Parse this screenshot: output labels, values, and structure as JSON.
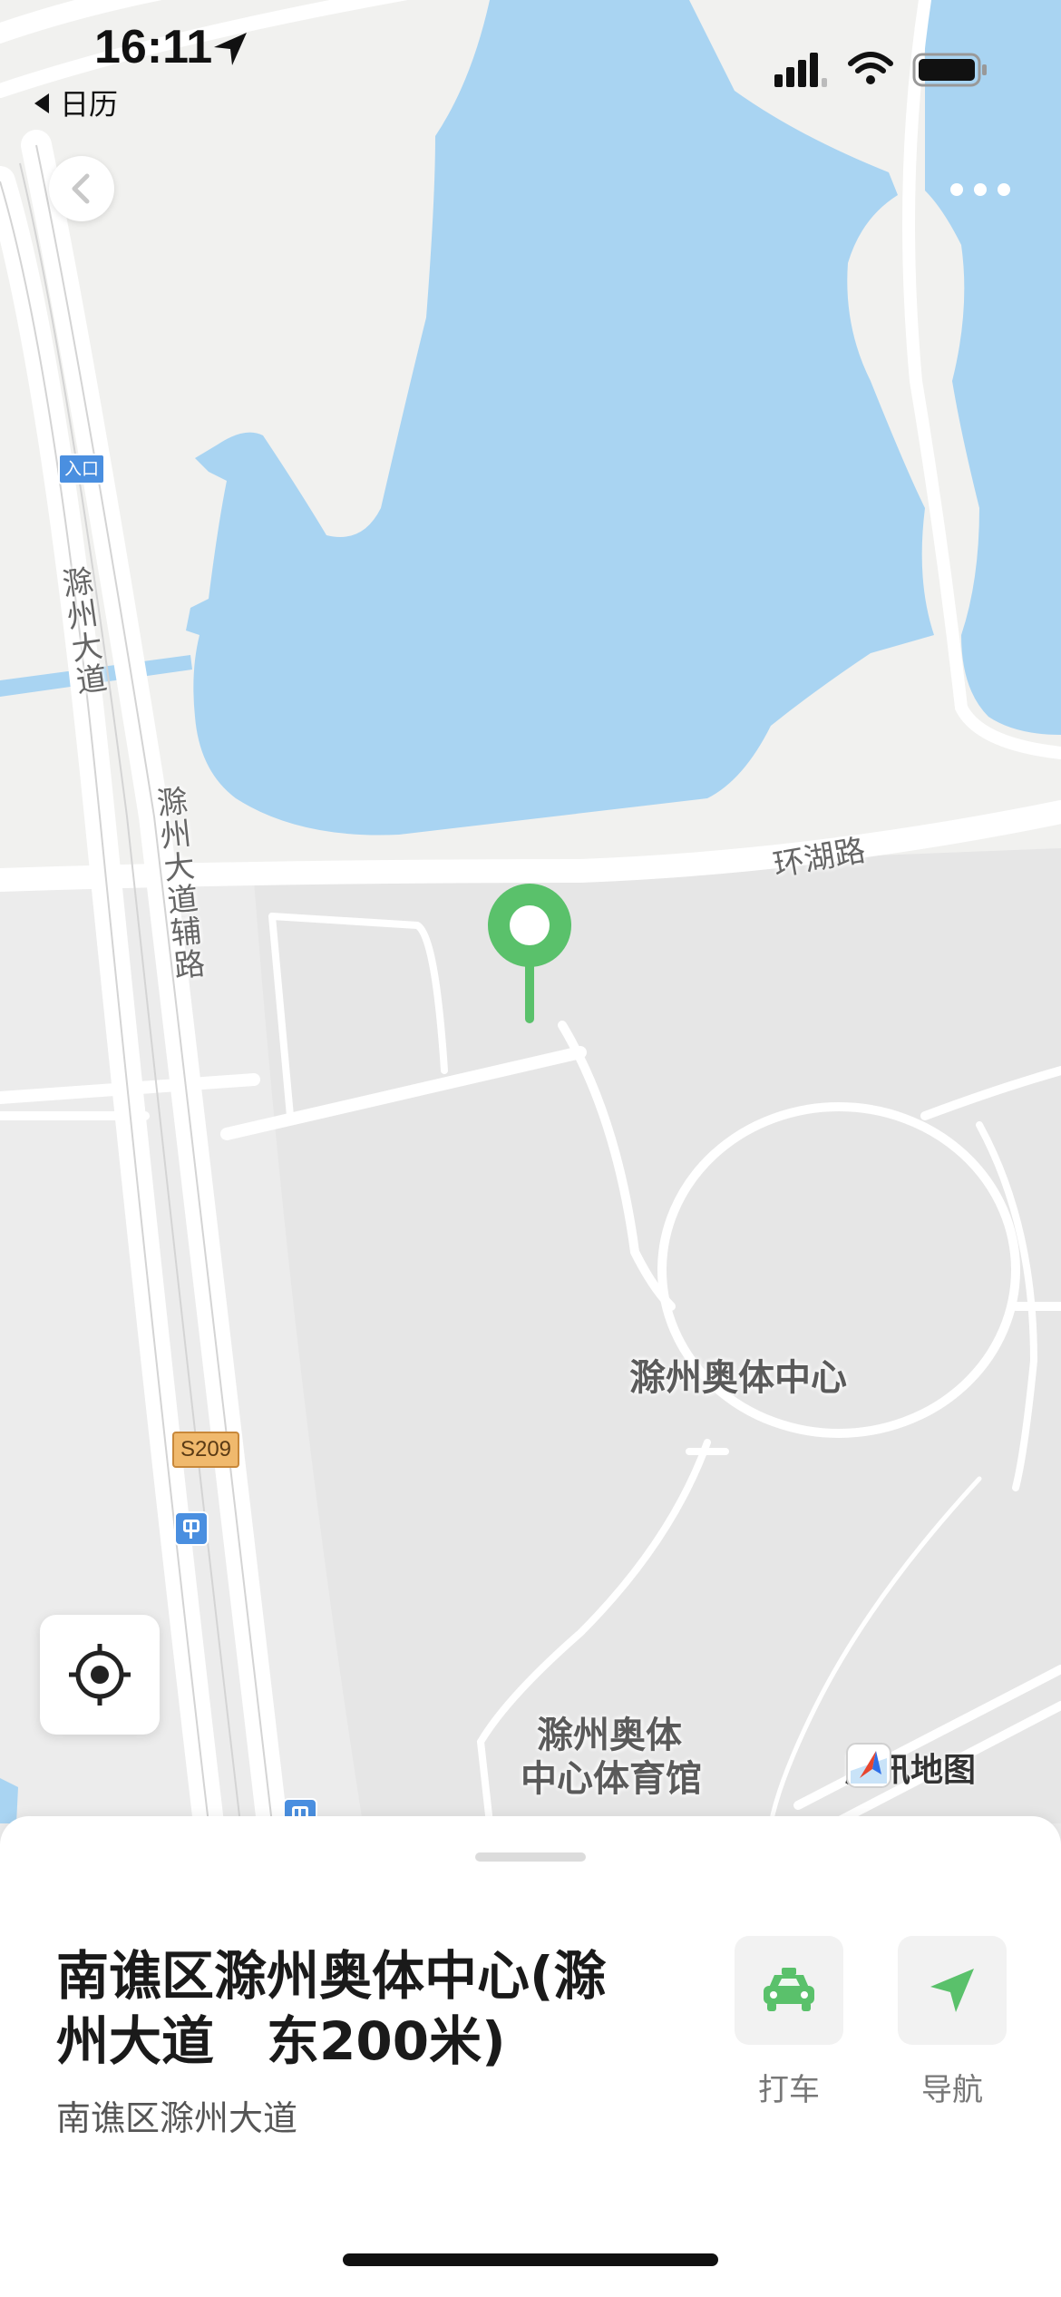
{
  "status_bar": {
    "time": "16:11",
    "back_app": "日历"
  },
  "map": {
    "road_labels": {
      "chuzhou_avenue": "滁州大道",
      "chuzhou_avenue_service_road": "滁州大道辅路",
      "lakeside_road": "环湖路"
    },
    "highway_shield": "S209",
    "entrance_tag": "入口",
    "poi": {
      "sports_center": "滁州奥体中心",
      "gymnasium_line1": "滁州奥体",
      "gymnasium_line2": "中心体育馆"
    },
    "logo_text": "腾讯地图",
    "colors": {
      "water": "#a9d4f2",
      "land": "#ececec",
      "shore": "#f3f3f1",
      "road": "#ffffff",
      "pin": "#5ac16b"
    }
  },
  "place": {
    "title": "南谯区滁州奥体中心(滁州大道　东200米)",
    "subtitle": "南谯区滁州大道"
  },
  "actions": {
    "taxi_label": "打车",
    "navigate_label": "导航",
    "accent": "#5ac16b"
  }
}
